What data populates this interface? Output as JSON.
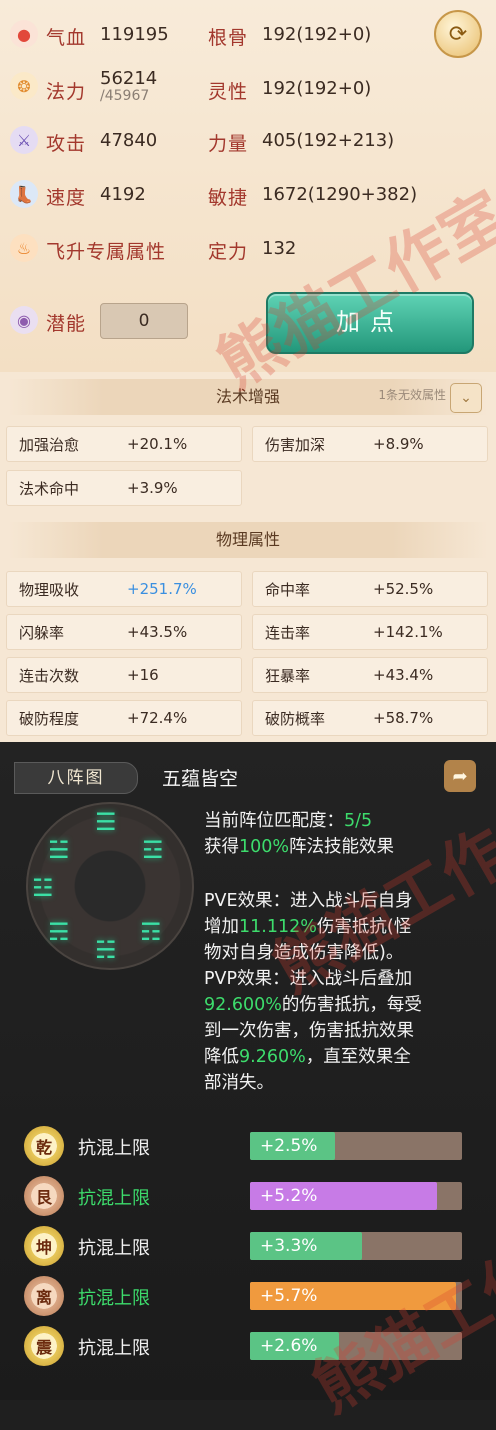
{
  "stats": {
    "hp": {
      "label": "气血",
      "value": "119195"
    },
    "mana": {
      "label": "法力",
      "value": "56214",
      "max": "/45967"
    },
    "attack": {
      "label": "攻击",
      "value": "47840"
    },
    "speed": {
      "label": "速度",
      "value": "4192"
    },
    "ascend": {
      "label": "飞升专属属性"
    },
    "constitution": {
      "label": "根骨",
      "value": "192(192+0)"
    },
    "spirit": {
      "label": "灵性",
      "value": "192(192+0)"
    },
    "strength": {
      "label": "力量",
      "value": "405(192+213)"
    },
    "agility": {
      "label": "敏捷",
      "value": "1672(1290+382)"
    },
    "focus": {
      "label": "定力",
      "value": "132"
    },
    "potential": {
      "label": "潜能",
      "value": "0"
    },
    "add_point_label": "加点"
  },
  "magic": {
    "title": "法术增强",
    "invalid_note": "1条无效属性",
    "items": [
      {
        "name": "加强治愈",
        "value": "+20.1%"
      },
      {
        "name": "伤害加深",
        "value": "+8.9%"
      },
      {
        "name": "法术命中",
        "value": "+3.9%"
      }
    ]
  },
  "physical": {
    "title": "物理属性",
    "items": [
      {
        "name": "物理吸收",
        "value": "+251.7%"
      },
      {
        "name": "命中率",
        "value": "+52.5%"
      },
      {
        "name": "闪躲率",
        "value": "+43.5%"
      },
      {
        "name": "连击率",
        "value": "+142.1%"
      },
      {
        "name": "连击次数",
        "value": "+16"
      },
      {
        "name": "狂暴率",
        "value": "+43.4%"
      },
      {
        "name": "破防程度",
        "value": "+72.4%"
      },
      {
        "name": "破防概率",
        "value": "+58.7%"
      }
    ]
  },
  "formation": {
    "tab": "八阵图",
    "name": "五蕴皆空",
    "trigrams": [
      "☰",
      "☱",
      "☲",
      "☳",
      "☴",
      "☵"
    ],
    "match_prefix": "当前阵位匹配度：",
    "match_value": "5/5",
    "gain_prefix": "获得",
    "gain_value": "100%",
    "gain_suffix": "阵法技能效果",
    "pve_l1": "PVE效果：进入战斗后自身",
    "pve_l2a": "增加",
    "pve_val": "11.112%",
    "pve_l2b": "伤害抵抗(怪",
    "pve_l3": "物对自身造成伤害降低)。",
    "pvp_l1": "PVP效果：进入战斗后叠加",
    "pvp_val1": "92.600%",
    "pvp_l2b": "的伤害抵抗，每受",
    "pvp_l3": "到一次伤害，伤害抵抗效果",
    "pvp_l4a": "降低",
    "pvp_val2": "9.260%",
    "pvp_l4b": "，直至效果全",
    "pvp_l5": "部消失。",
    "rows": [
      {
        "badge": "乾",
        "label": "抗混上限",
        "value": "+2.5%",
        "fill": 0.4,
        "color": "#5bc485",
        "label_color": "#f2f2f2"
      },
      {
        "badge": "艮",
        "label": "抗混上限",
        "value": "+5.2%",
        "fill": 0.88,
        "color": "#c77be6",
        "label_color": "#3ddc6c"
      },
      {
        "badge": "坤",
        "label": "抗混上限",
        "value": "+3.3%",
        "fill": 0.53,
        "color": "#5bc485",
        "label_color": "#f2f2f2"
      },
      {
        "badge": "离",
        "label": "抗混上限",
        "value": "+5.7%",
        "fill": 0.97,
        "color": "#f09a3e",
        "label_color": "#3ddc6c"
      },
      {
        "badge": "震",
        "label": "抗混上限",
        "value": "+2.6%",
        "fill": 0.42,
        "color": "#5bc485",
        "label_color": "#f2f2f2"
      }
    ]
  }
}
